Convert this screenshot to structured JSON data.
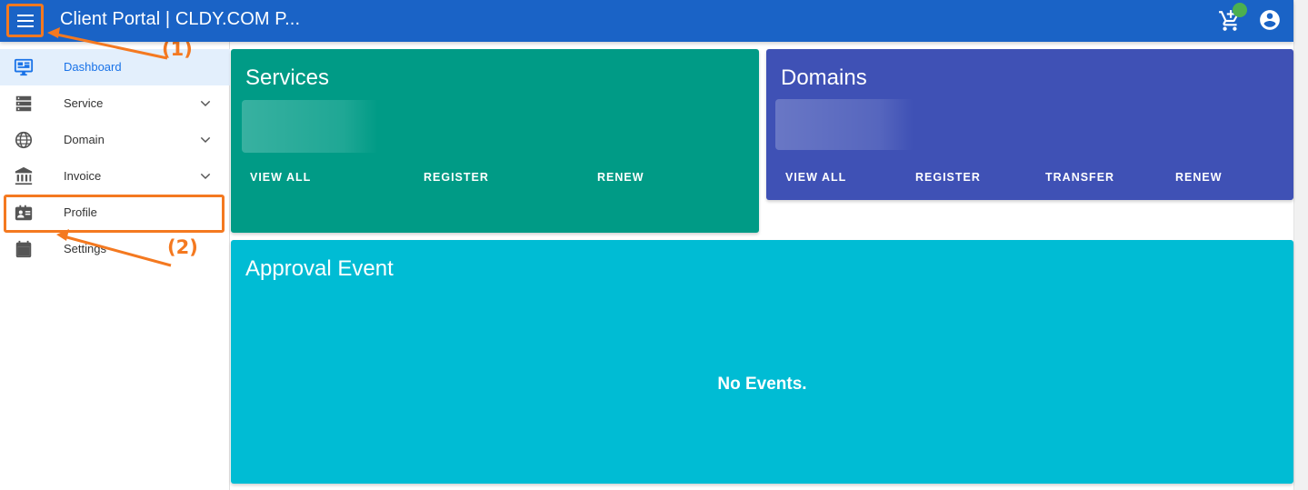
{
  "header": {
    "title": "Client Portal | CLDY.COM P...",
    "menu_icon": "hamburger-menu-icon",
    "cart_icon": "cart-icon",
    "account_icon": "account-circle-icon",
    "badge_color": "#4caf50"
  },
  "sidebar": {
    "items": [
      {
        "label": "Dashboard",
        "icon": "monitor-icon",
        "active": true
      },
      {
        "label": "Service",
        "icon": "server-icon",
        "expandable": true
      },
      {
        "label": "Domain",
        "icon": "globe-icon",
        "expandable": true
      },
      {
        "label": "Invoice",
        "icon": "bank-icon",
        "expandable": true
      },
      {
        "label": "Profile",
        "icon": "id-card-icon"
      },
      {
        "label": "Settings",
        "icon": "calendar-icon"
      }
    ]
  },
  "cards": {
    "services": {
      "title": "Services",
      "color": "#009b86",
      "actions": [
        "VIEW ALL",
        "REGISTER",
        "RENEW"
      ]
    },
    "domains": {
      "title": "Domains",
      "color": "#3f51b5",
      "actions": [
        "VIEW ALL",
        "REGISTER",
        "TRANSFER",
        "RENEW"
      ]
    },
    "approval": {
      "title": "Approval Event",
      "color": "#00bcd4",
      "empty_text": "No Events."
    }
  },
  "annotations": {
    "step1": "(1)",
    "step2": "(2)",
    "color": "#f47920"
  }
}
